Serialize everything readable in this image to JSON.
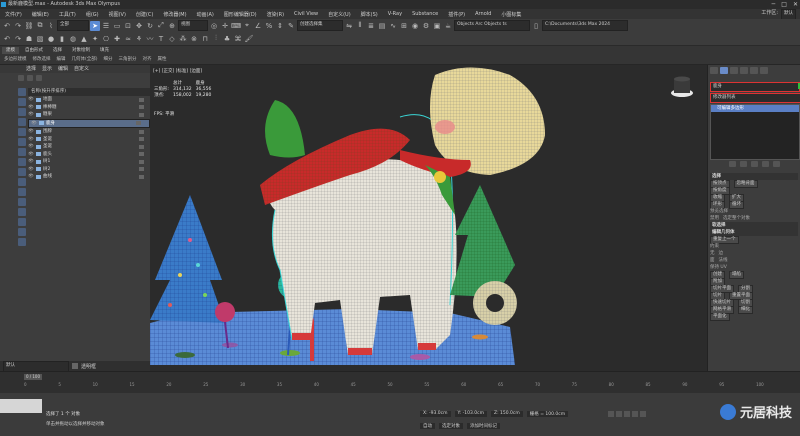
{
  "titlebar": {
    "title": "最新鹿模型.max - Autodesk 3ds Max Olympus",
    "min": "─",
    "max": "□",
    "close": "✕"
  },
  "menu": {
    "items": [
      "文件(F)",
      "编辑(E)",
      "工具(T)",
      "组(G)",
      "视图(V)",
      "创建(C)",
      "修改器(M)",
      "动画(A)",
      "图形编辑器(D)",
      "渲染(R)",
      "Civil View",
      "自定义(U)",
      "脚本(S)",
      "V-Ray",
      "Substance",
      "插件(P)",
      "Arnold",
      "小图标集"
    ],
    "workspace_label": "工作区:",
    "workspace_value": "默认"
  },
  "toolbar": {
    "filter_select": "全部",
    "view_select": "视图",
    "selection_set": "创建选择集",
    "objects_field": "Objects Arc Objects ts",
    "path_field": "C:\\Documents\\3ds Max 2024"
  },
  "ribbon": {
    "tabs": [
      "建模",
      "自由形式",
      "选择",
      "对象绘制",
      "填充"
    ],
    "sub": [
      "多边形建模",
      "修改选择",
      "编辑",
      "几何体(全部)",
      "细分",
      "三角剖分",
      "对齐",
      "属性"
    ]
  },
  "scene": {
    "tabs": [
      "选择",
      "显示",
      "编辑",
      "自定义"
    ],
    "header": "名称(按升序排序)",
    "items": [
      {
        "name": "地面"
      },
      {
        "name": "棒棒糖"
      },
      {
        "name": "糖果"
      },
      {
        "name": "鹿身"
      },
      {
        "name": "围脖"
      },
      {
        "name": "圣诞"
      },
      {
        "name": "圣诞"
      },
      {
        "name": "鹿头"
      },
      {
        "name": "树1"
      },
      {
        "name": "树2"
      },
      {
        "name": "曲线"
      }
    ],
    "selected_index": 3,
    "bottom_label": "默认",
    "bottom_right": "透明框"
  },
  "viewport": {
    "label": "[+] [正交] [标准] [边面]",
    "stats": {
      "header_total": "总计",
      "header_sel": "鹿身",
      "row1_label": "三角形:",
      "row1_total": "314,132",
      "row1_sel": "36,556",
      "row2_label": "顶点:",
      "row2_total": "158,002",
      "row2_sel": "19,280"
    },
    "fps": "FPS: 平滑"
  },
  "panel": {
    "name": "鹿身",
    "modifier_list": "修改器列表",
    "stack_item": "可编辑多边形",
    "sections": [
      "选择",
      "按顶点",
      "忽略背面",
      "按角度",
      "收缩",
      "扩大",
      "环形",
      "循环",
      "预览选择",
      "禁用",
      "选定整个对象",
      "软选择",
      "编辑几何体",
      "重复上一个",
      "约束",
      "无",
      "边",
      "面",
      "法线",
      "保持 UV",
      "创建",
      "塌陷",
      "附加",
      "切片平面",
      "分割",
      "切片",
      "重置平面",
      "快速切片",
      "切割",
      "网格平滑",
      "细化",
      "平面化"
    ]
  },
  "timeline": {
    "frame": "0 / 100",
    "ticks": [
      "0",
      "5",
      "10",
      "15",
      "20",
      "25",
      "30",
      "35",
      "40",
      "45",
      "50",
      "55",
      "60",
      "65",
      "70",
      "75",
      "80",
      "85",
      "90",
      "95",
      "100"
    ]
  },
  "status": {
    "selected": "选择了 1 个 对象",
    "hint": "单击并拖动以选择并移动对象",
    "x": "X: -93.0cm",
    "y": "Y: -103.0cm",
    "z": "Z: 150.0cm",
    "grid": "栅格 = 100.0cm",
    "autokey": "自动",
    "setkey": "选定对象",
    "addtime": "添加时间标记"
  },
  "watermark": {
    "text": "元居科技"
  }
}
